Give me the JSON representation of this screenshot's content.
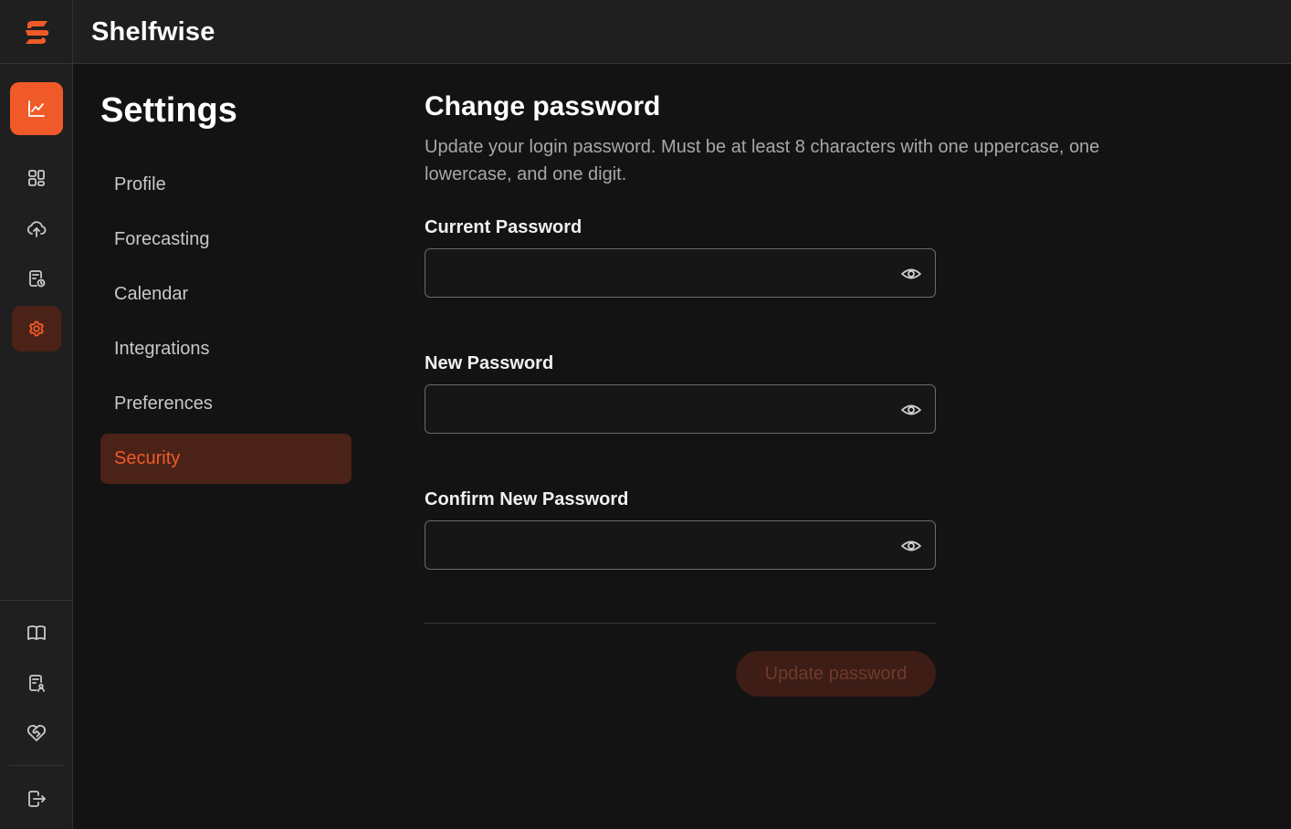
{
  "app": {
    "name": "Shelfwise",
    "accent_color": "#f05a28"
  },
  "rail": {
    "top_items": [
      {
        "icon": "chart-line-icon",
        "state": "primary"
      },
      {
        "icon": "dashboard-grid-icon",
        "state": "default"
      },
      {
        "icon": "cloud-upload-icon",
        "state": "default"
      },
      {
        "icon": "report-clock-icon",
        "state": "default"
      },
      {
        "icon": "gear-icon",
        "state": "active"
      }
    ],
    "bottom_items": [
      {
        "icon": "book-open-icon"
      },
      {
        "icon": "report-user-icon"
      },
      {
        "icon": "heart-handshake-icon"
      },
      {
        "icon": "logout-icon"
      }
    ]
  },
  "settings": {
    "title": "Settings",
    "nav": [
      {
        "label": "Profile",
        "active": false
      },
      {
        "label": "Forecasting",
        "active": false
      },
      {
        "label": "Calendar",
        "active": false
      },
      {
        "label": "Integrations",
        "active": false
      },
      {
        "label": "Preferences",
        "active": false
      },
      {
        "label": "Security",
        "active": true
      }
    ]
  },
  "form": {
    "title": "Change password",
    "description": "Update your login password. Must be at least 8 characters with one uppercase, one lowercase, and one digit.",
    "fields": [
      {
        "label": "Current Password",
        "value": ""
      },
      {
        "label": "New Password",
        "value": ""
      },
      {
        "label": "Confirm New Password",
        "value": ""
      }
    ],
    "submit_label": "Update password",
    "submit_disabled": true
  }
}
